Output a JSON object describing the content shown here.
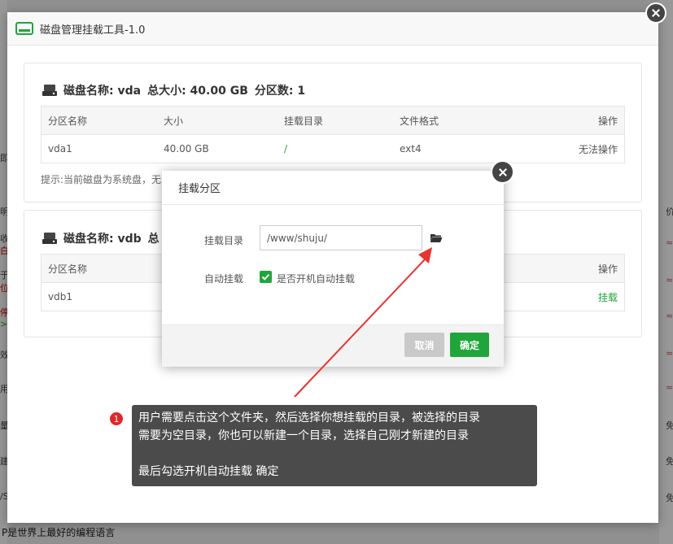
{
  "outer_dialog": {
    "title": "磁盘管理挂载工具-1.0"
  },
  "disk1": {
    "title_name": "磁盘名称: vda",
    "title_size": "总大小: 40.00 GB",
    "title_parts": "分区数: 1",
    "headers": [
      "分区名称",
      "大小",
      "挂载目录",
      "文件格式",
      "操作"
    ],
    "row": {
      "name": "vda1",
      "size": "40.00 GB",
      "mount": "/",
      "format": "ext4",
      "action": "无法操作"
    },
    "hint": "提示:当前磁盘为系统盘，无"
  },
  "disk2": {
    "title_name": "磁盘名称: vdb",
    "title_rest": "总",
    "headers": [
      "分区名称",
      "操作"
    ],
    "row": {
      "name": "vdb1",
      "action": "挂载"
    }
  },
  "mount_dialog": {
    "title": "挂载分区",
    "mount_dir_label": "挂载目录",
    "mount_dir_value": "/www/shuju/",
    "auto_mount_label": "自动挂载",
    "auto_mount_checkbox_label": "是否开机自动挂载",
    "auto_mount_checked": true,
    "cancel": "取消",
    "confirm": "确定"
  },
  "tooltip": {
    "step": "1",
    "line1": "用户需要点击这个文件夹，然后选择你想挂载的目录，被选择的目录",
    "line2": "需要为空目录，你也可以新建一个目录，选择自己刚才新建的目录",
    "line3": "最后勾选开机自动挂载  确定"
  },
  "background": {
    "bottom_text": "P是世界上最好的编程语言",
    "right_col": [
      "价",
      "≈",
      "≈",
      "≈",
      "≈",
      "≈",
      "免",
      "免",
      "免"
    ],
    "left_col": [
      "即",
      "明",
      "收",
      "白",
      "于",
      "位",
      "停",
      ">",
      "效",
      "用",
      "量",
      "建",
      "/S"
    ]
  },
  "colors": {
    "accent_green": "#20a53a",
    "tip_bg": "#4b4b4b",
    "arrow_red": "#e8332f"
  }
}
